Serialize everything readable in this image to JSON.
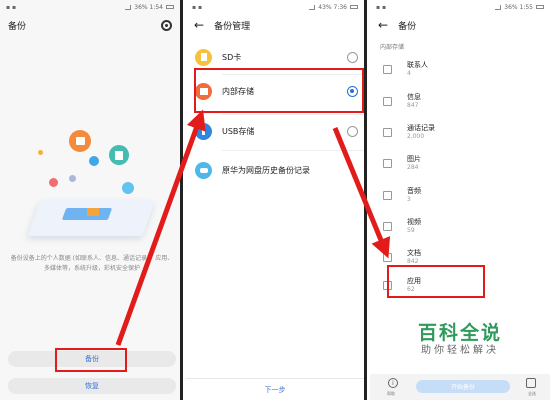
{
  "panel1": {
    "status": {
      "right": "36% 1:54"
    },
    "title": "备份",
    "description": "备份设备上的个人数据 (如联系人、信息、通话记录)、应用、多媒体等，系统升级，彩机安全保护",
    "backup_label": "备份",
    "restore_label": "恢复"
  },
  "panel2": {
    "status": {
      "right": "43% 7:36"
    },
    "title": "备份管理",
    "items": [
      {
        "label": "SD卡",
        "color": "#f6c23e"
      },
      {
        "label": "内部存储",
        "color": "#f26b3a"
      },
      {
        "label": "USB存储",
        "color": "#2d86e0"
      },
      {
        "label": "原华为网盘历史备份记录",
        "color": "#4fb8e8"
      }
    ],
    "next_label": "下一步"
  },
  "panel3": {
    "status": {
      "right": "36% 1:55"
    },
    "title": "备份",
    "section": "内部存储",
    "items": [
      {
        "name": "联系人",
        "count": "4"
      },
      {
        "name": "信息",
        "count": "847"
      },
      {
        "name": "通话记录",
        "count": "2,000"
      },
      {
        "name": "图片",
        "count": "284"
      },
      {
        "name": "音频",
        "count": "3"
      },
      {
        "name": "视频",
        "count": "59"
      },
      {
        "name": "文档",
        "count": "842"
      },
      {
        "name": "应用",
        "count": "62"
      }
    ],
    "help_label": "帮助",
    "start_label": "开始备份",
    "select_label": "全选"
  },
  "watermark": {
    "line1": "百科全说",
    "line2": "助你轻松解决"
  },
  "colors": {
    "accent": "#2b6fd6",
    "highlight": "#e21b1b",
    "watermark": "#2f9a5c"
  }
}
